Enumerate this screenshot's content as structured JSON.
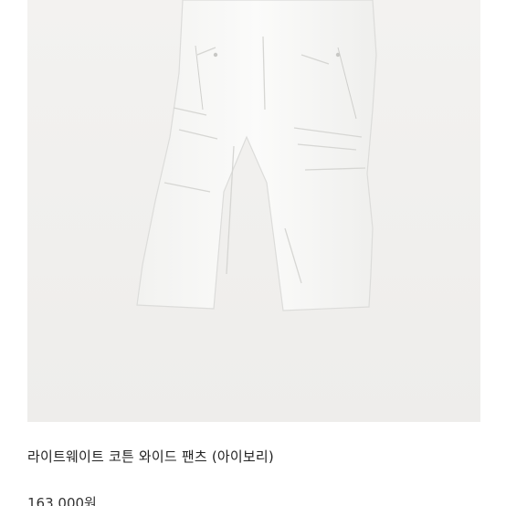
{
  "product": {
    "image_alt": "white wide cargo pants",
    "title": "라이트웨이트 코튼 와이드 팬츠 (아이보리)",
    "price": "163,000원"
  },
  "colors": {
    "image_background": "#f1f0ee",
    "garment": "#f7f7f5",
    "title_text": "#222222"
  }
}
